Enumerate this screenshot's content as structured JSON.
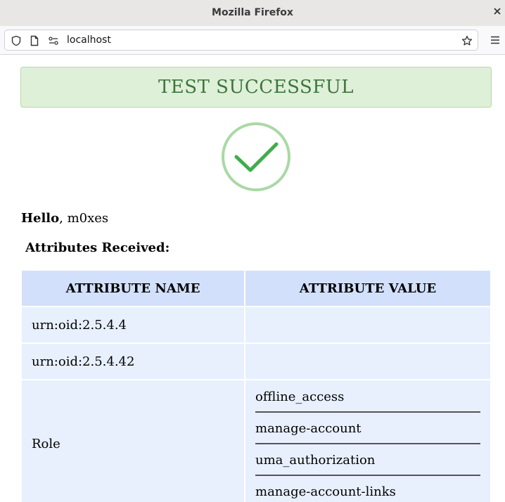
{
  "browser": {
    "window_title": "Mozilla Firefox",
    "url": "localhost"
  },
  "page": {
    "banner": "TEST SUCCESSFUL",
    "greeting_bold": "Hello",
    "greeting_rest": ", m0xes",
    "attributes_heading": "Attributes Received:",
    "table": {
      "headers": [
        "ATTRIBUTE NAME",
        "ATTRIBUTE VALUE"
      ],
      "rows": [
        {
          "name": "urn:oid:2.5.4.4",
          "value": ""
        },
        {
          "name": "urn:oid:2.5.4.42",
          "value": ""
        },
        {
          "name": "Role",
          "values": [
            "offline_access",
            "manage-account",
            "uma_authorization",
            "manage-account-links"
          ]
        }
      ]
    }
  },
  "colors": {
    "banner_bg": "#dff0d8",
    "banner_text": "#3c763d",
    "header_bg": "#d2e0fb",
    "cell_bg": "#e8f0fe",
    "check_green": "#3fae49"
  }
}
